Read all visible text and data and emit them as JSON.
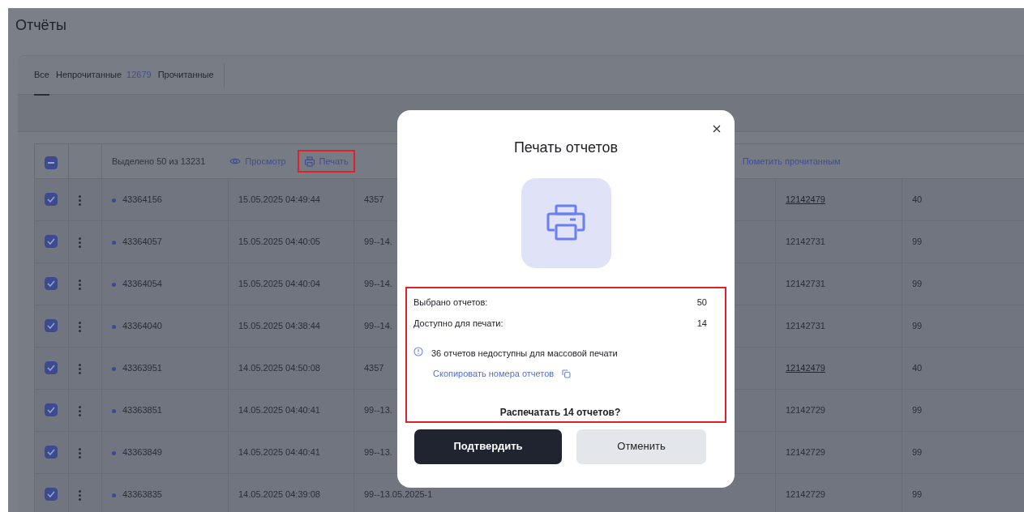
{
  "page": {
    "title": "Отчёты"
  },
  "tabs": [
    {
      "label": "Все",
      "selected": true
    },
    {
      "label": "Непрочитанные",
      "count": "12679",
      "selected": false
    },
    {
      "label": "Прочитанные",
      "selected": false
    }
  ],
  "table": {
    "select_all_indeterminate": true,
    "selection_text": "Выделено 50 из 13231",
    "actions": [
      {
        "kind": "view",
        "label": "Просмотр",
        "highlighted": false
      },
      {
        "kind": "print",
        "label": "Печать",
        "highlighted": true
      },
      {
        "kind": "mark",
        "label": "Пометить прочитанным",
        "highlighted": false
      }
    ],
    "rows": [
      {
        "checked": true,
        "unread": true,
        "number": "43364156",
        "date": "15.05.2025 04:49:44",
        "column_5": "4357",
        "column_6": "12142479",
        "linked": true,
        "column_7": "40"
      },
      {
        "checked": true,
        "unread": true,
        "number": "43364057",
        "date": "15.05.2025 04:40:05",
        "column_5": "99--14.",
        "column_6": "12142731",
        "linked": false,
        "column_7": "99"
      },
      {
        "checked": true,
        "unread": true,
        "number": "43364054",
        "date": "15.05.2025 04:40:04",
        "column_5": "99--14.",
        "column_6": "12142731",
        "linked": false,
        "column_7": "99"
      },
      {
        "checked": true,
        "unread": true,
        "number": "43364040",
        "date": "15.05.2025 04:38:44",
        "column_5": "99--14.",
        "column_6": "12142731",
        "linked": false,
        "column_7": "99"
      },
      {
        "checked": true,
        "unread": true,
        "number": "43363951",
        "date": "14.05.2025 04:50:08",
        "column_5": "4357",
        "column_6": "12142479",
        "linked": true,
        "column_7": "40"
      },
      {
        "checked": true,
        "unread": true,
        "number": "43363851",
        "date": "14.05.2025 04:40:41",
        "column_5": "99--13.",
        "column_6": "12142729",
        "linked": false,
        "column_7": "99"
      },
      {
        "checked": true,
        "unread": true,
        "number": "43363849",
        "date": "14.05.2025 04:40:41",
        "column_5": "99--13.",
        "column_6": "12142729",
        "linked": false,
        "column_7": "99"
      },
      {
        "checked": true,
        "unread": true,
        "number": "43363835",
        "date": "14.05.2025 04:39:08",
        "column_5": "99--13.05.2025-1",
        "column_6": "12142729",
        "linked": false,
        "column_7": "99"
      }
    ]
  },
  "modal": {
    "title": "Печать отчетов",
    "highlighted": true,
    "stats": [
      {
        "label": "Выбрано отчетов:",
        "value": "50"
      },
      {
        "label": "Доступно для печати:",
        "value": "14"
      }
    ],
    "notice": "36 отчетов недоступны для массовой печати",
    "copy_link": "Скопировать номера отчетов",
    "question": "Распечатать 14 отчетов?",
    "buttons": [
      {
        "kind": "primary",
        "label": "Подтвердить"
      },
      {
        "kind": "secondary",
        "label": "Отменить"
      }
    ]
  }
}
